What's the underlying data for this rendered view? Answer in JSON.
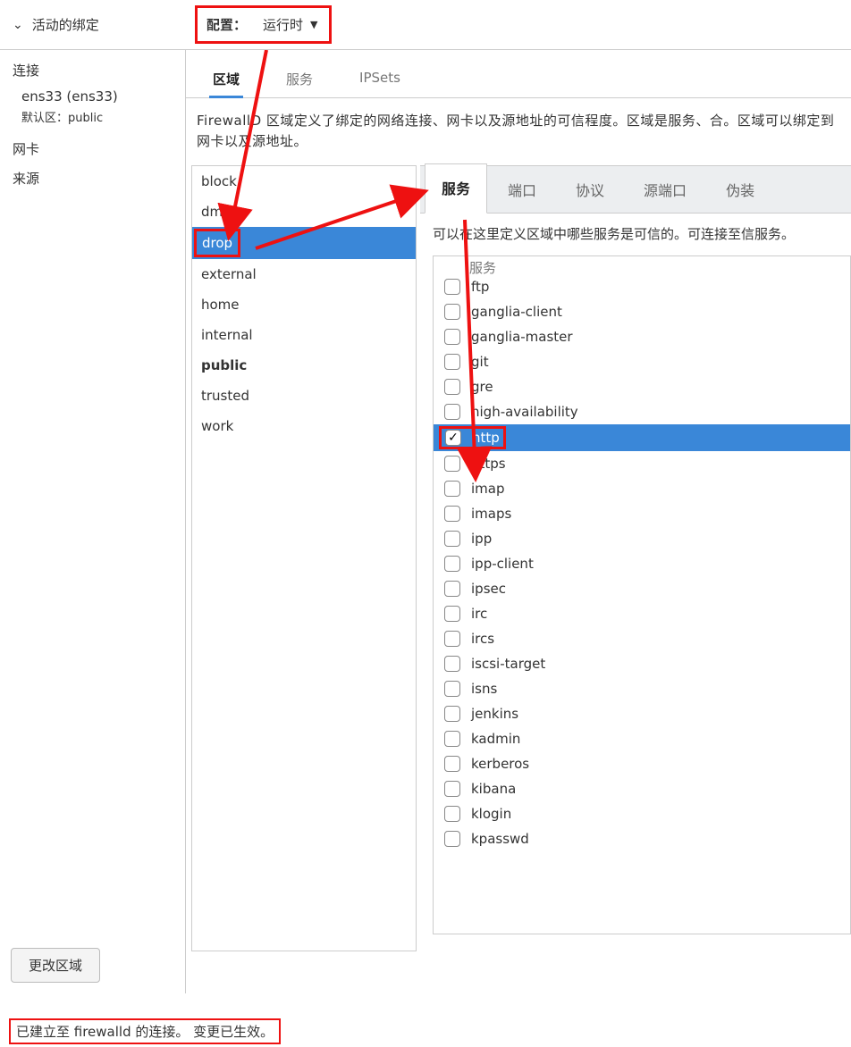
{
  "top": {
    "active_bindings": "活动的绑定",
    "config_label": "配置：",
    "config_value": "运行时"
  },
  "sidebar": {
    "connections": "连接",
    "iface": "ens33 (ens33)",
    "default_zone_label": "默认区：public",
    "nic": "网卡",
    "source": "来源",
    "change_zone": "更改区域"
  },
  "tabs": {
    "zones": "区域",
    "services": "服务",
    "ipsets": "IPSets"
  },
  "desc": "FirewallD 区域定义了绑定的网络连接、网卡以及源地址的可信程度。区域是服务、合。区域可以绑定到网卡以及源地址。",
  "zones": [
    {
      "name": "block"
    },
    {
      "name": "dmz"
    },
    {
      "name": "drop",
      "selected": true
    },
    {
      "name": "external"
    },
    {
      "name": "home"
    },
    {
      "name": "internal"
    },
    {
      "name": "public",
      "default": true
    },
    {
      "name": "trusted"
    },
    {
      "name": "work"
    }
  ],
  "sub_tabs": {
    "services": "服务",
    "ports": "端口",
    "protocols": "协议",
    "source_ports": "源端口",
    "masquerade": "伪装"
  },
  "sub_desc": "可以在这里定义区域中哪些服务是可信的。可连接至信服务。",
  "svc_header": "服务",
  "services": [
    {
      "name": "ftp",
      "checked": false
    },
    {
      "name": "ganglia-client",
      "checked": false
    },
    {
      "name": "ganglia-master",
      "checked": false
    },
    {
      "name": "git",
      "checked": false
    },
    {
      "name": "gre",
      "checked": false
    },
    {
      "name": "high-availability",
      "checked": false
    },
    {
      "name": "http",
      "checked": true,
      "selected": true
    },
    {
      "name": "https",
      "checked": false
    },
    {
      "name": "imap",
      "checked": false
    },
    {
      "name": "imaps",
      "checked": false
    },
    {
      "name": "ipp",
      "checked": false
    },
    {
      "name": "ipp-client",
      "checked": false
    },
    {
      "name": "ipsec",
      "checked": false
    },
    {
      "name": "irc",
      "checked": false
    },
    {
      "name": "ircs",
      "checked": false
    },
    {
      "name": "iscsi-target",
      "checked": false
    },
    {
      "name": "isns",
      "checked": false
    },
    {
      "name": "jenkins",
      "checked": false
    },
    {
      "name": "kadmin",
      "checked": false
    },
    {
      "name": "kerberos",
      "checked": false
    },
    {
      "name": "kibana",
      "checked": false
    },
    {
      "name": "klogin",
      "checked": false
    },
    {
      "name": "kpasswd",
      "checked": false
    }
  ],
  "status": "已建立至 firewalld 的连接。 变更已生效。"
}
